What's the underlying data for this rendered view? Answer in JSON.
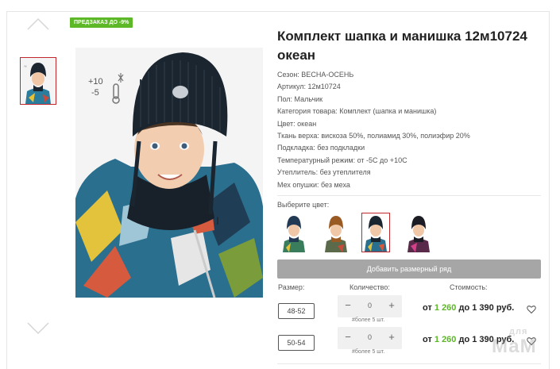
{
  "promo_badge": "ПРЕДЗАКАЗ ДО -9%",
  "product": {
    "title": "Комплект шапка и манишка 12м10724 океан",
    "specs": [
      "Сезон: ВЕСНА-ОСЕНЬ",
      "Артикул: 12м10724",
      "Пол: Мальчик",
      "Категория товара: Комплект (шапка и манишка)",
      "Цвет: океан",
      "Ткань верха: вискоза 50%, полиамид 30%, полиэфир 20%",
      "Подкладка: без подкладки",
      "Температурный режим: от -5С до +10С",
      "Утеплитель: без утеплителя",
      "Мех опушки: без меха"
    ]
  },
  "temperature_icon": {
    "plus": "+10",
    "minus": "-5",
    "icon": "thermometer-icon"
  },
  "color_select": {
    "label": "Выберите цвет:",
    "swatches": [
      "navy",
      "brown",
      "ocean",
      "black-pink"
    ],
    "selected_index": 2
  },
  "add_row_button": "Добавить размерный ряд",
  "table": {
    "size_header": "Размер:",
    "qty_header": "Количество:",
    "price_header": "Стоимость:",
    "rows": [
      {
        "size": "48-52",
        "qty": "0",
        "note": "#более 5 шт.",
        "price_from": "от ",
        "price_low": "1 260",
        "price_to": " до 1 390 руб."
      },
      {
        "size": "50-54",
        "qty": "0",
        "note": "#более 5 шт.",
        "price_from": "от ",
        "price_low": "1 260",
        "price_to": " до 1 390 руб."
      }
    ]
  },
  "qty_minus": "−",
  "qty_plus": "+",
  "watermark": {
    "small": "для",
    "big": "МаМ"
  },
  "colors": {
    "promo_green": "#5cb827",
    "selected_border": "#c0282d",
    "button_grey": "#a6a6a6",
    "price_green": "#5cb827"
  }
}
